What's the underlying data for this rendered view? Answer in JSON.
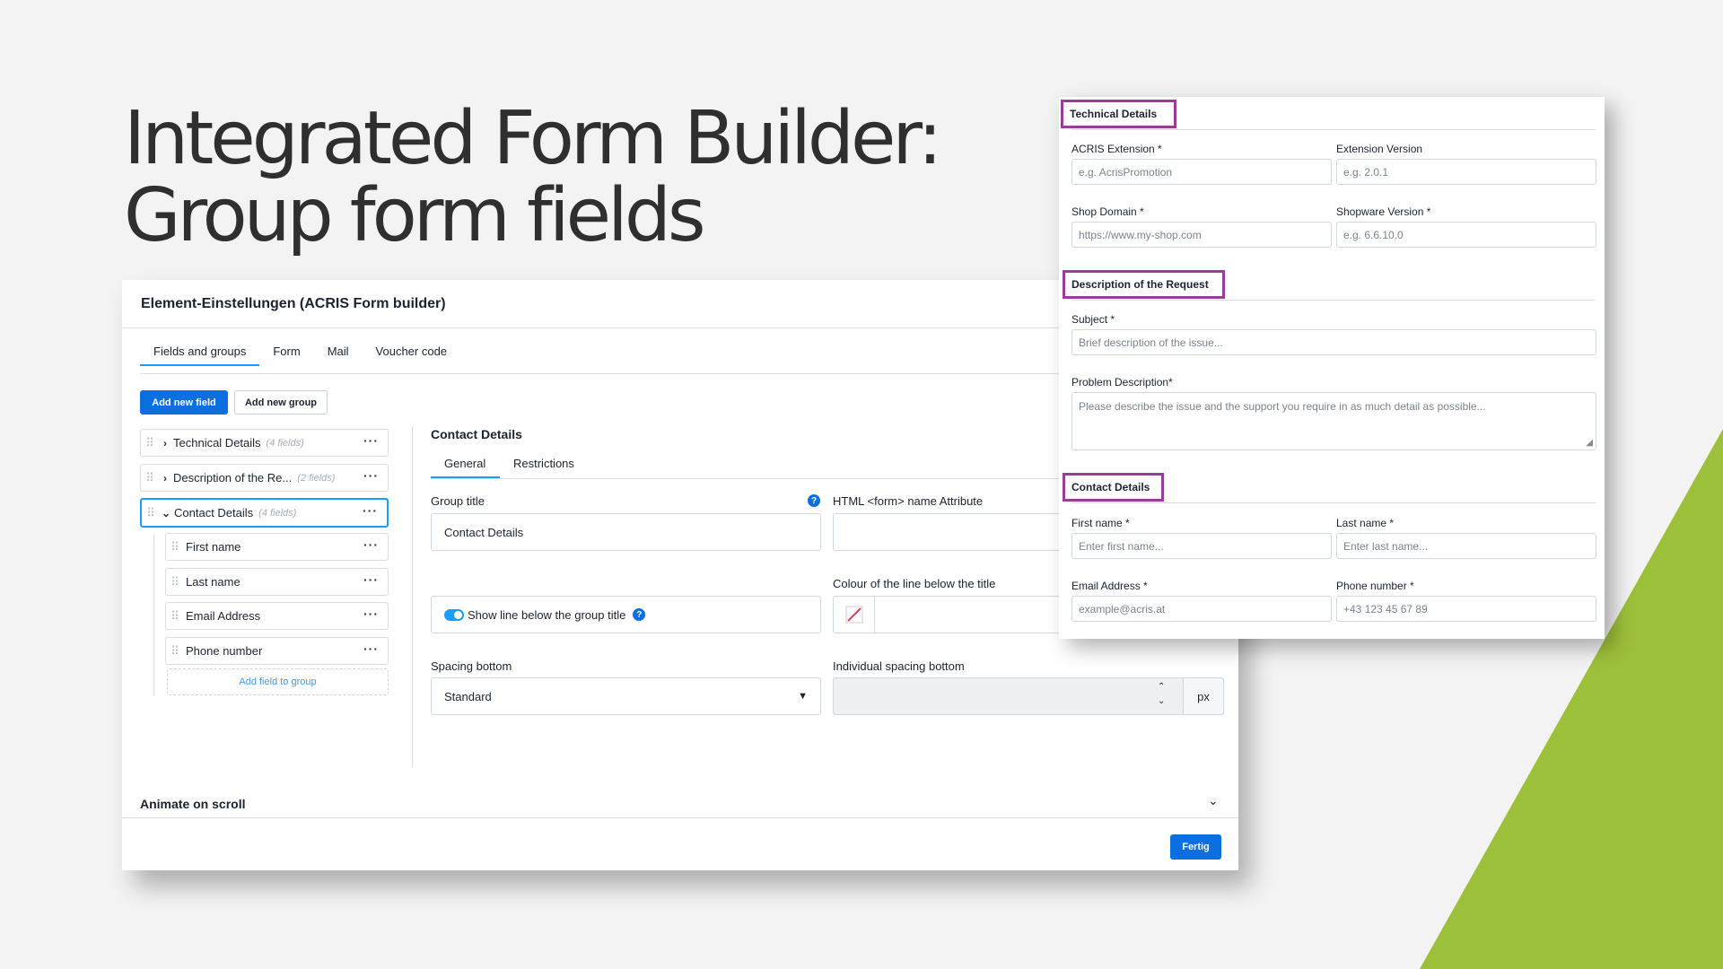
{
  "slide": {
    "title_line1": "Integrated Form Builder:",
    "title_line2": "Group form fields",
    "accent_color": "#9dc03a"
  },
  "admin": {
    "header_title": "Element-Einstellungen (ACRIS Form builder)",
    "tabs": [
      {
        "label": "Fields and groups",
        "active": true
      },
      {
        "label": "Form",
        "active": false
      },
      {
        "label": "Mail",
        "active": false
      },
      {
        "label": "Voucher code",
        "active": false
      }
    ],
    "add_field_button": "Add new field",
    "add_group_button": "Add new group",
    "tree": {
      "groups": [
        {
          "label": "Technical Details",
          "count": "(4 fields)",
          "expanded": false
        },
        {
          "label": "Description of the Re...",
          "count": "(2 fields)",
          "expanded": false
        },
        {
          "label": "Contact Details",
          "count": "(4 fields)",
          "expanded": true
        }
      ],
      "children": [
        "First name",
        "Last name",
        "Email Address",
        "Phone number"
      ],
      "add_field_to_group": "Add field to group"
    },
    "detail": {
      "title": "Contact Details",
      "subtabs": [
        "General",
        "Restrictions"
      ],
      "group_title_label": "Group title",
      "group_title_value": "Contact Details",
      "html_name_label": "HTML <form> name Attribute",
      "line_colour_label": "Colour of the line below the title",
      "show_line_label": "Show line below the group title",
      "spacing_bottom_label": "Spacing bottom",
      "spacing_bottom_value": "Standard",
      "individual_spacing_label": "Individual spacing bottom",
      "unit": "px",
      "help_glyph": "?"
    },
    "animate_label": "Animate on scroll",
    "done_button": "Fertig",
    "primary_color": "#0b6fe0"
  },
  "preview": {
    "sections": [
      {
        "heading": "Technical Details",
        "fields": [
          {
            "label": "ACRIS Extension *",
            "placeholder": "e.g. AcrisPromotion"
          },
          {
            "label": "Extension Version",
            "placeholder": "e.g. 2.0.1"
          },
          {
            "label": "Shop Domain *",
            "placeholder": "https://www.my-shop.com"
          },
          {
            "label": "Shopware Version *",
            "placeholder": "e.g. 6.6.10.0"
          }
        ]
      },
      {
        "heading": "Description of the Request",
        "fields": [
          {
            "label": "Subject *",
            "placeholder": "Brief description of the issue..."
          },
          {
            "label": "Problem Description*",
            "placeholder": "Please describe the issue and the support you require in as much detail as possible..."
          }
        ]
      },
      {
        "heading": "Contact Details",
        "fields": [
          {
            "label": "First name *",
            "placeholder": "Enter first name..."
          },
          {
            "label": "Last name *",
            "placeholder": "Enter last name..."
          },
          {
            "label": "Email Address *",
            "placeholder": "example@acris.at"
          },
          {
            "label": "Phone number *",
            "placeholder": "+43 123 45 67 89"
          }
        ]
      }
    ],
    "highlight_color": "#9b3d98"
  }
}
